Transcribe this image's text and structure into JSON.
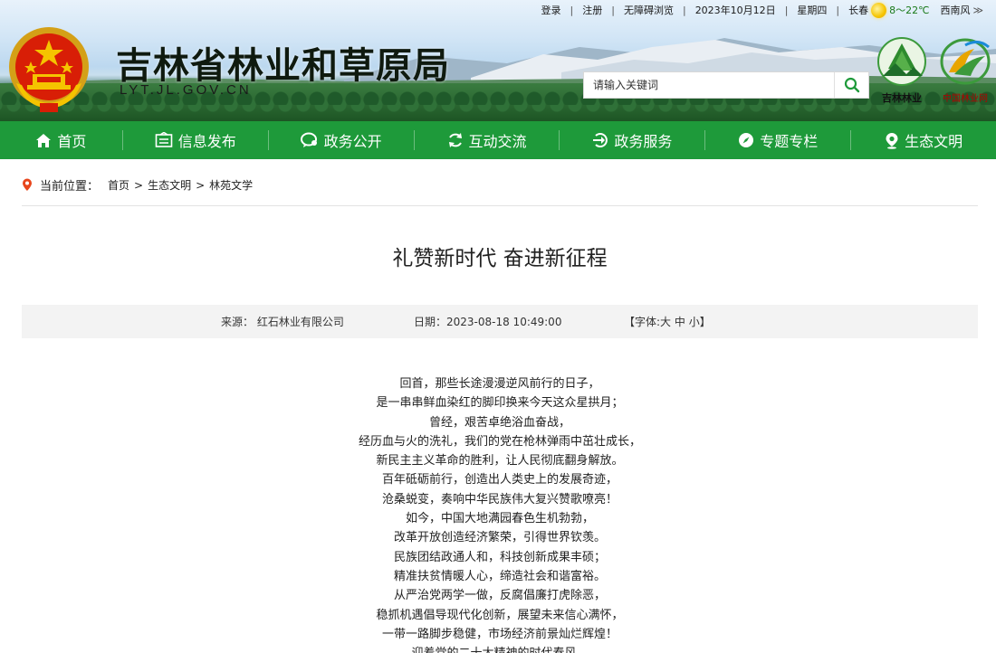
{
  "top_bar": {
    "login": "登录",
    "register": "注册",
    "accessible": "无障碍浏览",
    "date": "2023年10月12日",
    "weekday": "星期四",
    "city": "长春",
    "temperature": "8～22℃",
    "wind": "西南风",
    "more": "≫"
  },
  "header": {
    "title": "吉林省林业和草原局",
    "domain": "LYT.JL.GOV.CN",
    "search_placeholder": "请输入关键词",
    "logo1_label": "吉林林业",
    "logo2_label": "中国林业网"
  },
  "nav": [
    {
      "label": "首页",
      "icon": "home-icon"
    },
    {
      "label": "信息发布",
      "icon": "info-icon"
    },
    {
      "label": "政务公开",
      "icon": "chat-icon"
    },
    {
      "label": "互动交流",
      "icon": "refresh-icon"
    },
    {
      "label": "政务服务",
      "icon": "service-icon"
    },
    {
      "label": "专题专栏",
      "icon": "compass-icon"
    },
    {
      "label": "生态文明",
      "icon": "pin-icon"
    }
  ],
  "breadcrumb": {
    "label": "当前位置：",
    "items": [
      "首页",
      "生态文明",
      "林苑文学"
    ],
    "separator": ">"
  },
  "article": {
    "title": "礼赞新时代 奋进新征程",
    "source": "来源： 红石林业有限公司",
    "date": "日期：2023-08-18 10:49:00",
    "font_open": "【字体:",
    "font_large": "大",
    "font_medium": "中",
    "font_small": "小",
    "font_close": "】",
    "lines": [
      "回首，那些长途漫漫逆风前行的日子，",
      "是一串串鲜血染红的脚印换来今天这众星拱月；",
      "曾经，艰苦卓绝浴血奋战，",
      "经历血与火的洗礼，我们的党在枪林弹雨中茁壮成长，",
      "新民主主义革命的胜利，让人民彻底翻身解放。",
      "百年砥砺前行，创造出人类史上的发展奇迹，",
      "沧桑蜕变，奏响中华民族伟大复兴赞歌嘹亮！",
      "如今，中国大地满园春色生机勃勃，",
      "改革开放创造经济繁荣，引得世界钦羡。",
      "民族团结政通人和，科技创新成果丰硕；",
      "精准扶贫情暖人心，缔造社会和谐富裕。",
      "从严治党两学一做，反腐倡廉打虎除恶，",
      "稳抓机遇倡导现代化创新，展望未来信心满怀，",
      "一带一路脚步稳健，市场经济前景灿烂辉煌！",
      "迎着党的二十大精神的时代春风，"
    ]
  },
  "colors": {
    "nav_green": "#1e9a3a",
    "pin_red": "#e8461c"
  }
}
